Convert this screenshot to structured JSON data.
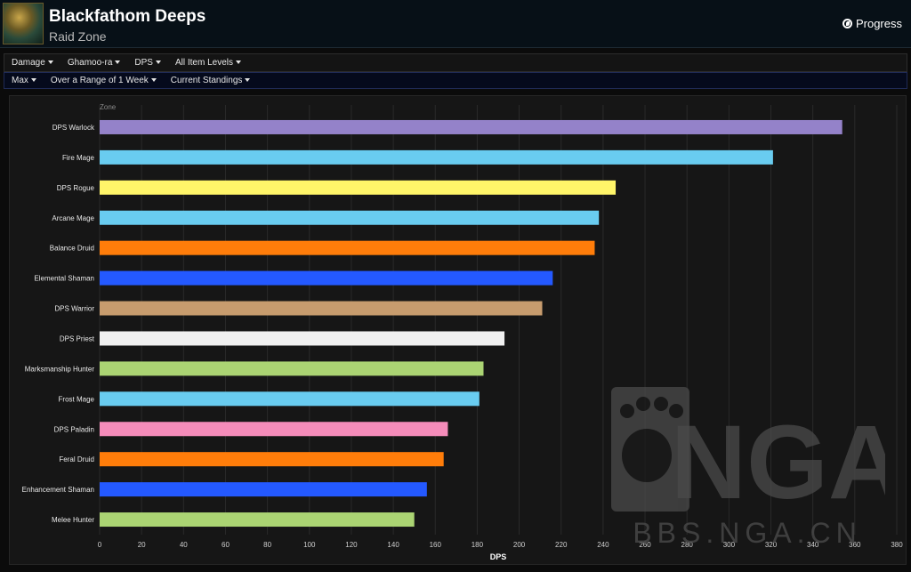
{
  "header": {
    "title": "Blackfathom Deeps",
    "subtitle": "Raid Zone",
    "progress_label": "Progress"
  },
  "filters_row1": [
    "Damage",
    "Ghamoo-ra",
    "DPS",
    "All Item Levels"
  ],
  "filters_row2": [
    "Max",
    "Over a Range of 1 Week",
    "Current Standings"
  ],
  "watermark": {
    "text": "NGA",
    "url_text": "BBS.NGA.CN"
  },
  "chart_data": {
    "type": "bar",
    "orientation": "horizontal",
    "series_label": "Zone",
    "xlabel": "DPS",
    "xlim": [
      0,
      380
    ],
    "xticks": [
      0,
      20,
      40,
      60,
      80,
      100,
      120,
      140,
      160,
      180,
      200,
      220,
      240,
      260,
      280,
      300,
      320,
      340,
      360,
      380
    ],
    "grid": true,
    "categories": [
      "DPS Warlock",
      "Fire Mage",
      "DPS Rogue",
      "Arcane Mage",
      "Balance Druid",
      "Elemental Shaman",
      "DPS Warrior",
      "DPS Priest",
      "Marksmanship Hunter",
      "Frost Mage",
      "DPS Paladin",
      "Feral Druid",
      "Enhancement Shaman",
      "Melee Hunter"
    ],
    "values": [
      354,
      321,
      246,
      238,
      236,
      216,
      211,
      193,
      183,
      181,
      166,
      164,
      156,
      150
    ],
    "colors": [
      "#9482c9",
      "#69ccf0",
      "#fff569",
      "#69ccf0",
      "#ff7d0a",
      "#2459ff",
      "#c79c6e",
      "#f0f0f0",
      "#abd473",
      "#69ccf0",
      "#f58cba",
      "#ff7d0a",
      "#2459ff",
      "#abd473"
    ]
  }
}
